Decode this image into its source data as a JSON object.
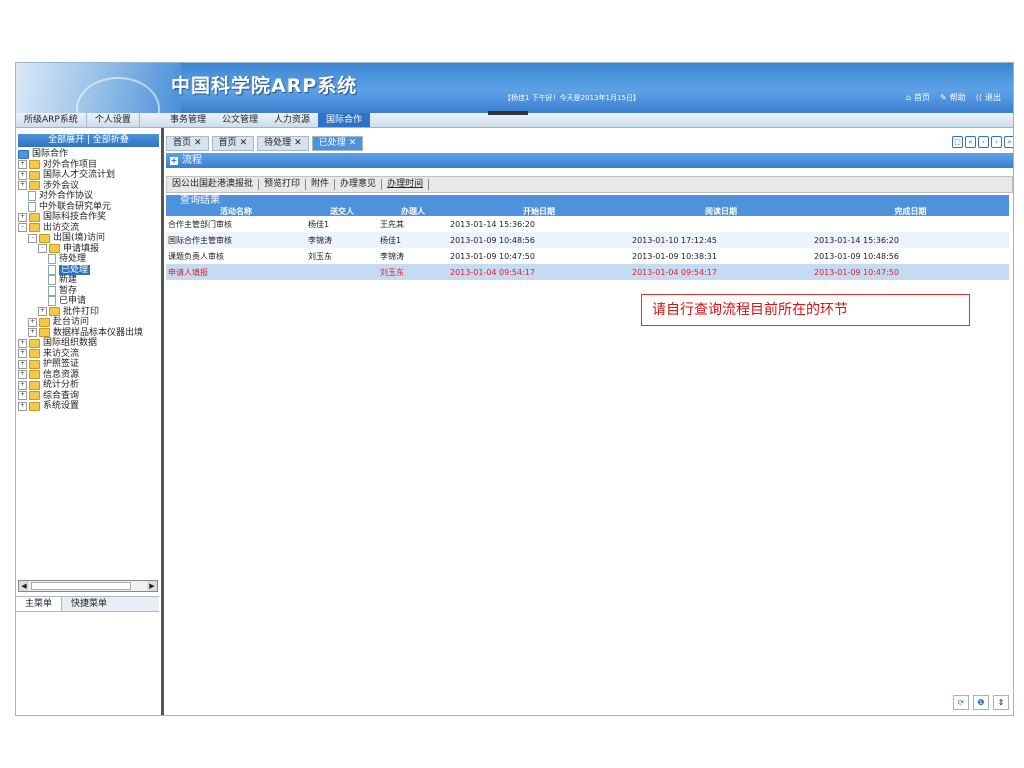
{
  "header": {
    "title": "中国科学院ARP系统",
    "greeting": "【杨佳1 下午好！今天是2013年1月15日】",
    "links": [
      {
        "icon": "home-icon",
        "label": "首页"
      },
      {
        "icon": "help-icon",
        "label": "帮助"
      },
      {
        "icon": "exit-icon",
        "label": "退出"
      }
    ]
  },
  "nav": {
    "left_tabs": [
      "所级ARP系统",
      "个人设置"
    ],
    "menu": [
      "事务管理",
      "公文管理",
      "人力资源",
      "国际合作"
    ],
    "active_menu": "国际合作"
  },
  "sidebar": {
    "expand_label": "全部展开 | 全部折叠",
    "tree": [
      {
        "label": "国际合作",
        "level": 0,
        "type": "root"
      },
      {
        "label": "对外合作项目",
        "level": 0,
        "type": "folder",
        "pm": "+"
      },
      {
        "label": "国际人才交流计划",
        "level": 0,
        "type": "folder",
        "pm": "+"
      },
      {
        "label": "涉外会议",
        "level": 0,
        "type": "folder",
        "pm": "+"
      },
      {
        "label": "对外合作协议",
        "level": 1,
        "type": "doc"
      },
      {
        "label": "中外联合研究单元",
        "level": 1,
        "type": "doc"
      },
      {
        "label": "国际科技合作奖",
        "level": 0,
        "type": "folder",
        "pm": "+"
      },
      {
        "label": "出访交流",
        "level": 0,
        "type": "folder",
        "pm": "-"
      },
      {
        "label": "出国(境)访问",
        "level": 1,
        "type": "folder",
        "pm": "-"
      },
      {
        "label": "申请填报",
        "level": 2,
        "type": "folder",
        "pm": "-"
      },
      {
        "label": "待处理",
        "level": 3,
        "type": "doc"
      },
      {
        "label": "已处理",
        "level": 3,
        "type": "doc",
        "selected": true
      },
      {
        "label": "新建",
        "level": 3,
        "type": "doc"
      },
      {
        "label": "暂存",
        "level": 3,
        "type": "doc"
      },
      {
        "label": "已申请",
        "level": 3,
        "type": "doc"
      },
      {
        "label": "批件打印",
        "level": 2,
        "type": "folder",
        "pm": "+"
      },
      {
        "label": "赴台访问",
        "level": 1,
        "type": "folder",
        "pm": "+"
      },
      {
        "label": "数据样品标本仪器出境",
        "level": 1,
        "type": "folder",
        "pm": "+"
      },
      {
        "label": "国际组织数据",
        "level": 0,
        "type": "folder",
        "pm": "+"
      },
      {
        "label": "来访交流",
        "level": 0,
        "type": "folder",
        "pm": "+"
      },
      {
        "label": "护照签证",
        "level": 0,
        "type": "folder",
        "pm": "+"
      },
      {
        "label": "信息资源",
        "level": 0,
        "type": "folder",
        "pm": "+"
      },
      {
        "label": "统计分析",
        "level": 0,
        "type": "folder",
        "pm": "+"
      },
      {
        "label": "综合查询",
        "level": 0,
        "type": "folder",
        "pm": "+"
      },
      {
        "label": "系统设置",
        "level": 0,
        "type": "folder",
        "pm": "+"
      }
    ],
    "bottom_tabs": [
      "主菜单",
      "快捷菜单"
    ]
  },
  "main": {
    "doc_tabs": [
      {
        "label": "首页"
      },
      {
        "label": "首页"
      },
      {
        "label": "待处理"
      },
      {
        "label": "已处理",
        "active": true
      }
    ],
    "flow_title": "流程",
    "toolbar": [
      "因公出国赴港澳报批",
      "预览打印",
      "附件",
      "办理意见",
      "办理时间"
    ],
    "results_title": "查询结果",
    "columns": [
      "活动名称",
      "送交人",
      "办理人",
      "开始日期",
      "阅读日期",
      "完成日期"
    ],
    "rows": [
      [
        "合作主管部门审核",
        "杨佳1",
        "王先其",
        "2013-01-14 15:36:20",
        "",
        ""
      ],
      [
        "国际合作主管审核",
        "李锦涛",
        "杨佳1",
        "2013-01-09 10:48:56",
        "2013-01-10 17:12:45",
        "2013-01-14 15:36:20"
      ],
      [
        "课题负责人审核",
        "刘玉东",
        "李锦涛",
        "2013-01-09 10:47:50",
        "2013-01-09 10:38:31",
        "2013-01-09 10:48:56"
      ],
      [
        "申请人填报",
        "",
        "刘玉东",
        "2013-01-04 09:54:17",
        "2013-01-04 09:54:17",
        "2013-01-09 10:47:50"
      ]
    ],
    "highlight_row": 3,
    "note": "请自行查询流程目前所在的环节"
  },
  "colors": {
    "accent": "#2e73c8",
    "highlight_text": "#d22222"
  }
}
